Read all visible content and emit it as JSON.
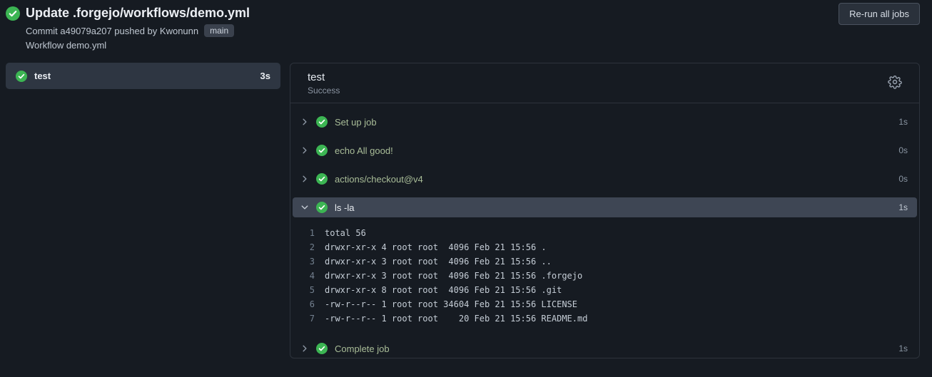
{
  "colors": {
    "page_bg": "#161b22",
    "success_green": "#3cb553",
    "selected_row_bg": "#3e4654",
    "sidebar_selected_bg": "#2e3642",
    "panel_border": "#2d333c",
    "step_name_green": "#a9bd98"
  },
  "header": {
    "title": "Update .forgejo/workflows/demo.yml",
    "commit_line": "Commit a49079a207 pushed by Kwonunn",
    "branch_badge": "main",
    "workflow_line": "Workflow demo.yml",
    "rerun_button_label": "Re-run all jobs"
  },
  "sidebar": {
    "jobs": [
      {
        "name": "test",
        "duration": "3s",
        "status": "success"
      }
    ]
  },
  "main": {
    "job_title": "test",
    "job_status": "Success",
    "gear_icon": "settings-gear",
    "steps": [
      {
        "name": "Set up job",
        "duration": "1s",
        "expanded": false,
        "status": "success"
      },
      {
        "name": "echo All good!",
        "duration": "0s",
        "expanded": false,
        "status": "success"
      },
      {
        "name": "actions/checkout@v4",
        "duration": "0s",
        "expanded": false,
        "status": "success"
      },
      {
        "name": "ls -la",
        "duration": "1s",
        "expanded": true,
        "status": "success"
      },
      {
        "name": "Complete job",
        "duration": "1s",
        "expanded": false,
        "status": "success"
      }
    ],
    "log": {
      "lines": [
        {
          "num": "1",
          "text": "total 56"
        },
        {
          "num": "2",
          "text": "drwxr-xr-x 4 root root  4096 Feb 21 15:56 ."
        },
        {
          "num": "3",
          "text": "drwxr-xr-x 3 root root  4096 Feb 21 15:56 .."
        },
        {
          "num": "4",
          "text": "drwxr-xr-x 3 root root  4096 Feb 21 15:56 .forgejo"
        },
        {
          "num": "5",
          "text": "drwxr-xr-x 8 root root  4096 Feb 21 15:56 .git"
        },
        {
          "num": "6",
          "text": "-rw-r--r-- 1 root root 34604 Feb 21 15:56 LICENSE"
        },
        {
          "num": "7",
          "text": "-rw-r--r-- 1 root root    20 Feb 21 15:56 README.md"
        }
      ]
    }
  }
}
